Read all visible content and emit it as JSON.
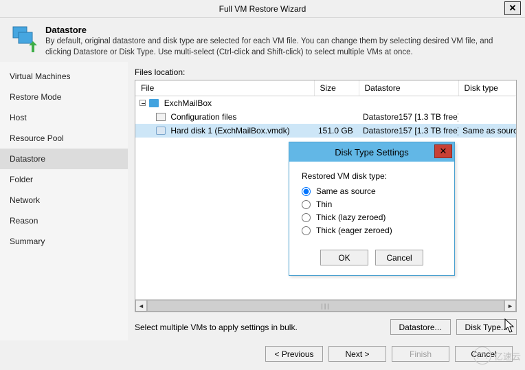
{
  "titlebar": {
    "title": "Full VM Restore Wizard"
  },
  "header": {
    "title": "Datastore",
    "description": "By default, original datastore and disk type are selected for each VM file. You can change them by selecting desired VM file, and clicking Datastore or Disk Type. Use multi-select (Ctrl-click and Shift-click) to select multiple VMs at once."
  },
  "sidebar": {
    "items": [
      {
        "label": "Virtual Machines"
      },
      {
        "label": "Restore Mode"
      },
      {
        "label": "Host"
      },
      {
        "label": "Resource Pool"
      },
      {
        "label": "Datastore"
      },
      {
        "label": "Folder"
      },
      {
        "label": "Network"
      },
      {
        "label": "Reason"
      },
      {
        "label": "Summary"
      }
    ],
    "active_index": 4
  },
  "files": {
    "location_label": "Files location:",
    "columns": {
      "file": "File",
      "size": "Size",
      "datastore": "Datastore",
      "disktype": "Disk type"
    },
    "rows": [
      {
        "level": 0,
        "name": "ExchMailBox",
        "size": "",
        "datastore": "",
        "disktype": "",
        "icon": "vm",
        "expanded": true
      },
      {
        "level": 1,
        "name": "Configuration files",
        "size": "",
        "datastore": "Datastore157 [1.3 TB free]",
        "disktype": "",
        "icon": "cfg"
      },
      {
        "level": 1,
        "name": "Hard disk 1 (ExchMailBox.vmdk)",
        "size": "151.0 GB",
        "datastore": "Datastore157 [1.3 TB free]",
        "disktype": "Same as source",
        "icon": "disk",
        "selected": true
      }
    ]
  },
  "bulk": {
    "hint": "Select multiple VMs to apply settings in bulk.",
    "datastore_btn": "Datastore...",
    "disktype_btn": "Disk Type..."
  },
  "modal": {
    "title": "Disk Type Settings",
    "group_label": "Restored VM disk type:",
    "options": [
      {
        "label": "Same as source",
        "checked": true
      },
      {
        "label": "Thin",
        "checked": false
      },
      {
        "label": "Thick (lazy zeroed)",
        "checked": false
      },
      {
        "label": "Thick (eager zeroed)",
        "checked": false
      }
    ],
    "ok": "OK",
    "cancel": "Cancel"
  },
  "footer": {
    "previous": "< Previous",
    "next": "Next >",
    "finish": "Finish",
    "cancel": "Cancel"
  },
  "watermark": "亿速云"
}
